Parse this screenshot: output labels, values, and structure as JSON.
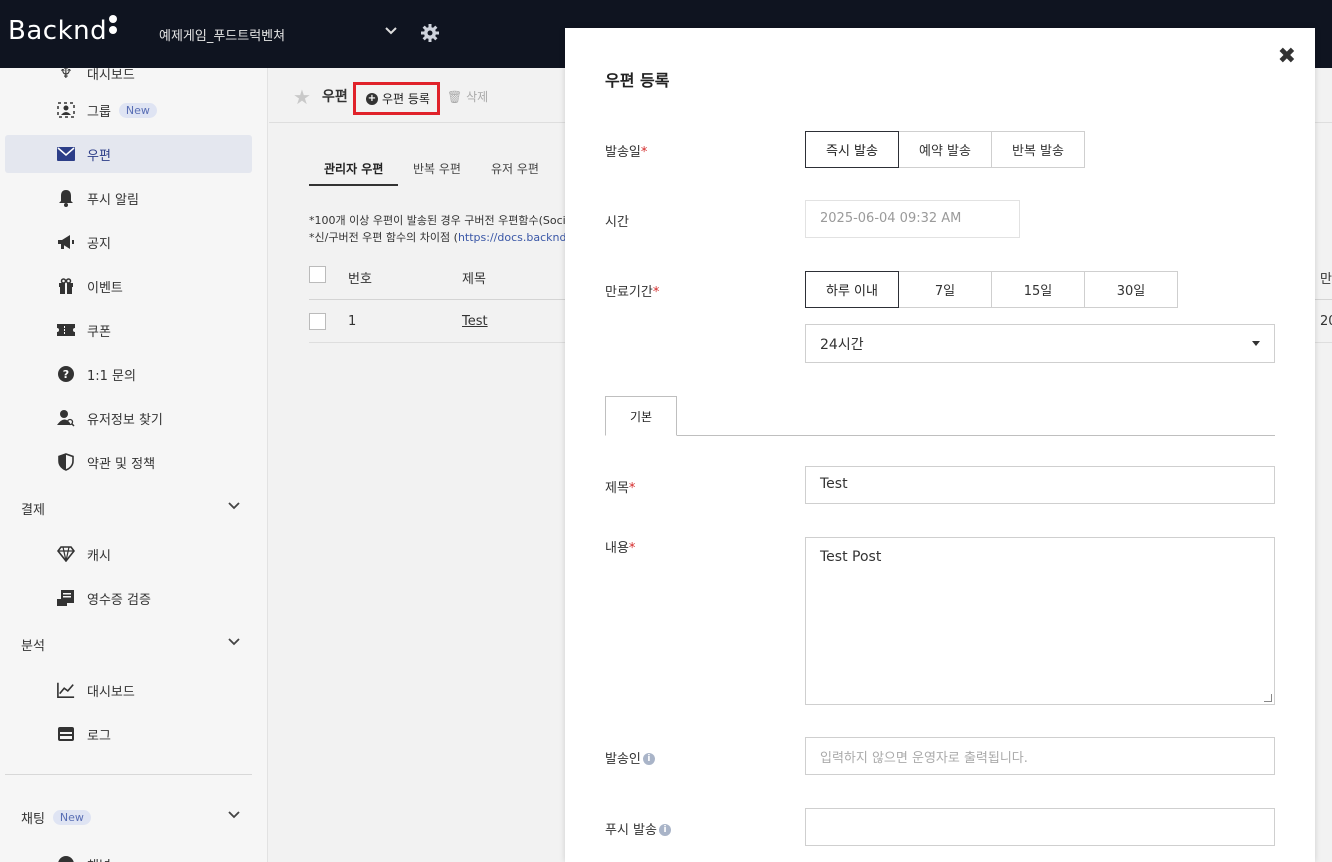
{
  "topbar": {
    "logo": "Backnd",
    "project_name": "예제게임_푸드트럭벤쳐"
  },
  "sidebar": {
    "partial_top_label": "대시보드",
    "items": [
      {
        "label": "그룹",
        "badge": "New",
        "icon": "group-icon"
      },
      {
        "label": "우편",
        "icon": "mail-icon",
        "active": true
      },
      {
        "label": "푸시 알림",
        "icon": "bell-icon"
      },
      {
        "label": "공지",
        "icon": "megaphone-icon"
      },
      {
        "label": "이벤트",
        "icon": "gift-icon"
      },
      {
        "label": "쿠폰",
        "icon": "ticket-icon"
      },
      {
        "label": "1:1 문의",
        "icon": "question-icon"
      },
      {
        "label": "유저정보 찾기",
        "icon": "user-search-icon"
      },
      {
        "label": "약관 및 정책",
        "icon": "shield-icon"
      }
    ],
    "group_payment": "결제",
    "payment_items": [
      {
        "label": "캐시",
        "icon": "diamond-icon"
      },
      {
        "label": "영수증 검증",
        "icon": "receipt-icon"
      }
    ],
    "group_analytics": "분석",
    "analytics_items": [
      {
        "label": "대시보드",
        "icon": "chart-icon"
      },
      {
        "label": "로그",
        "icon": "archive-icon"
      }
    ],
    "group_chat": "채팅",
    "group_chat_badge": "New",
    "partial_bottom_label": "채널"
  },
  "main": {
    "title": "우편",
    "register_label": "우편 등록",
    "delete_label": "삭제",
    "tabs": [
      "관리자 우편",
      "반복 우편",
      "유저 우편"
    ],
    "notice_1": "*100개 이상 우편이 발송된 경우 구버전 우편함수(Soci",
    "notice_2_prefix": "*신/구버전 우편 함수의 차이점 (",
    "notice_2_link": "https://docs.backnd",
    "table": {
      "headers": [
        "번호",
        "제목"
      ],
      "right_header_partial": "만",
      "rows": [
        {
          "no": "1",
          "title": "Test",
          "right_partial": "20"
        }
      ]
    }
  },
  "modal": {
    "title": "우편 등록",
    "send_date_label": "발송일",
    "send_options": [
      "즉시 발송",
      "예약 발송",
      "반복 발송"
    ],
    "send_selected": "즉시 발송",
    "time_label": "시간",
    "time_value": "2025-06-04 09:32 AM",
    "expire_label": "만료기간",
    "expire_options": [
      "하루 이내",
      "7일",
      "15일",
      "30일"
    ],
    "expire_selected": "하루 이내",
    "expire_select_value": "24시간",
    "form_tab": "기본",
    "subject_label": "제목",
    "subject_value": "Test",
    "content_label": "내용",
    "content_value": "Test Post",
    "sender_label": "발송인",
    "sender_placeholder": "입력하지 않으면 운영자로 출력됩니다.",
    "push_label": "푸시 발송",
    "push_value": ""
  },
  "colors": {
    "topbar": "#0f1420",
    "highlight_box": "#e0222a",
    "required": "#d42a2a",
    "active_sidebar": "#e4e7ef"
  }
}
